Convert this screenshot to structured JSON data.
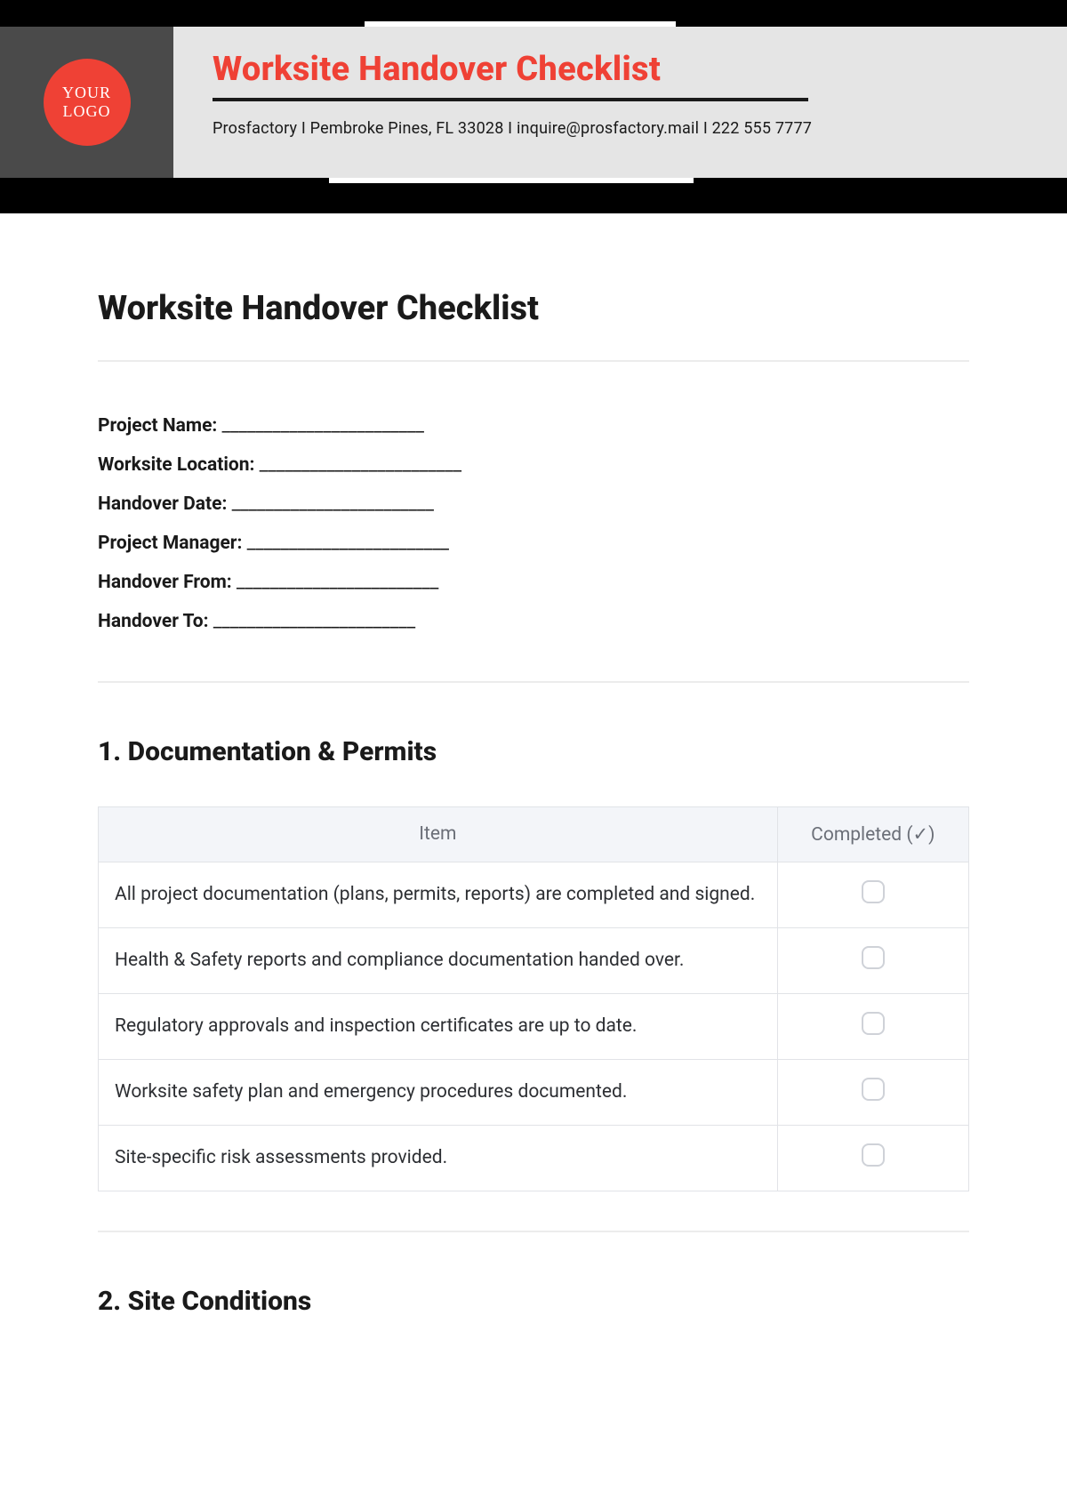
{
  "header": {
    "logo_line1": "YOUR",
    "logo_line2": "LOGO",
    "title": "Worksite Handover Checklist",
    "subline": "Prosfactory  I  Pembroke Pines, FL 33028 I  inquire@prosfactory.mail I 222 555 7777"
  },
  "doc_title": "Worksite Handover Checklist",
  "fields": [
    {
      "label": "Project Name:",
      "blank": " ________________________"
    },
    {
      "label": "Worksite Location:",
      "blank": " ________________________"
    },
    {
      "label": "Handover Date:",
      "blank": " ________________________"
    },
    {
      "label": "Project Manager:",
      "blank": " ________________________"
    },
    {
      "label": "Handover From:",
      "blank": " ________________________"
    },
    {
      "label": "Handover To:",
      "blank": " ________________________"
    }
  ],
  "section1": {
    "heading": "1. Documentation & Permits",
    "columns": {
      "item": "Item",
      "completed": "Completed (✓)"
    },
    "rows": [
      "All project documentation (plans, permits, reports) are completed and signed.",
      "Health & Safety reports and compliance documentation handed over.",
      "Regulatory approvals and inspection certificates are up to date.",
      "Worksite safety plan and emergency procedures documented.",
      "Site-specific risk assessments provided."
    ]
  },
  "section2": {
    "heading": "2. Site Conditions"
  }
}
